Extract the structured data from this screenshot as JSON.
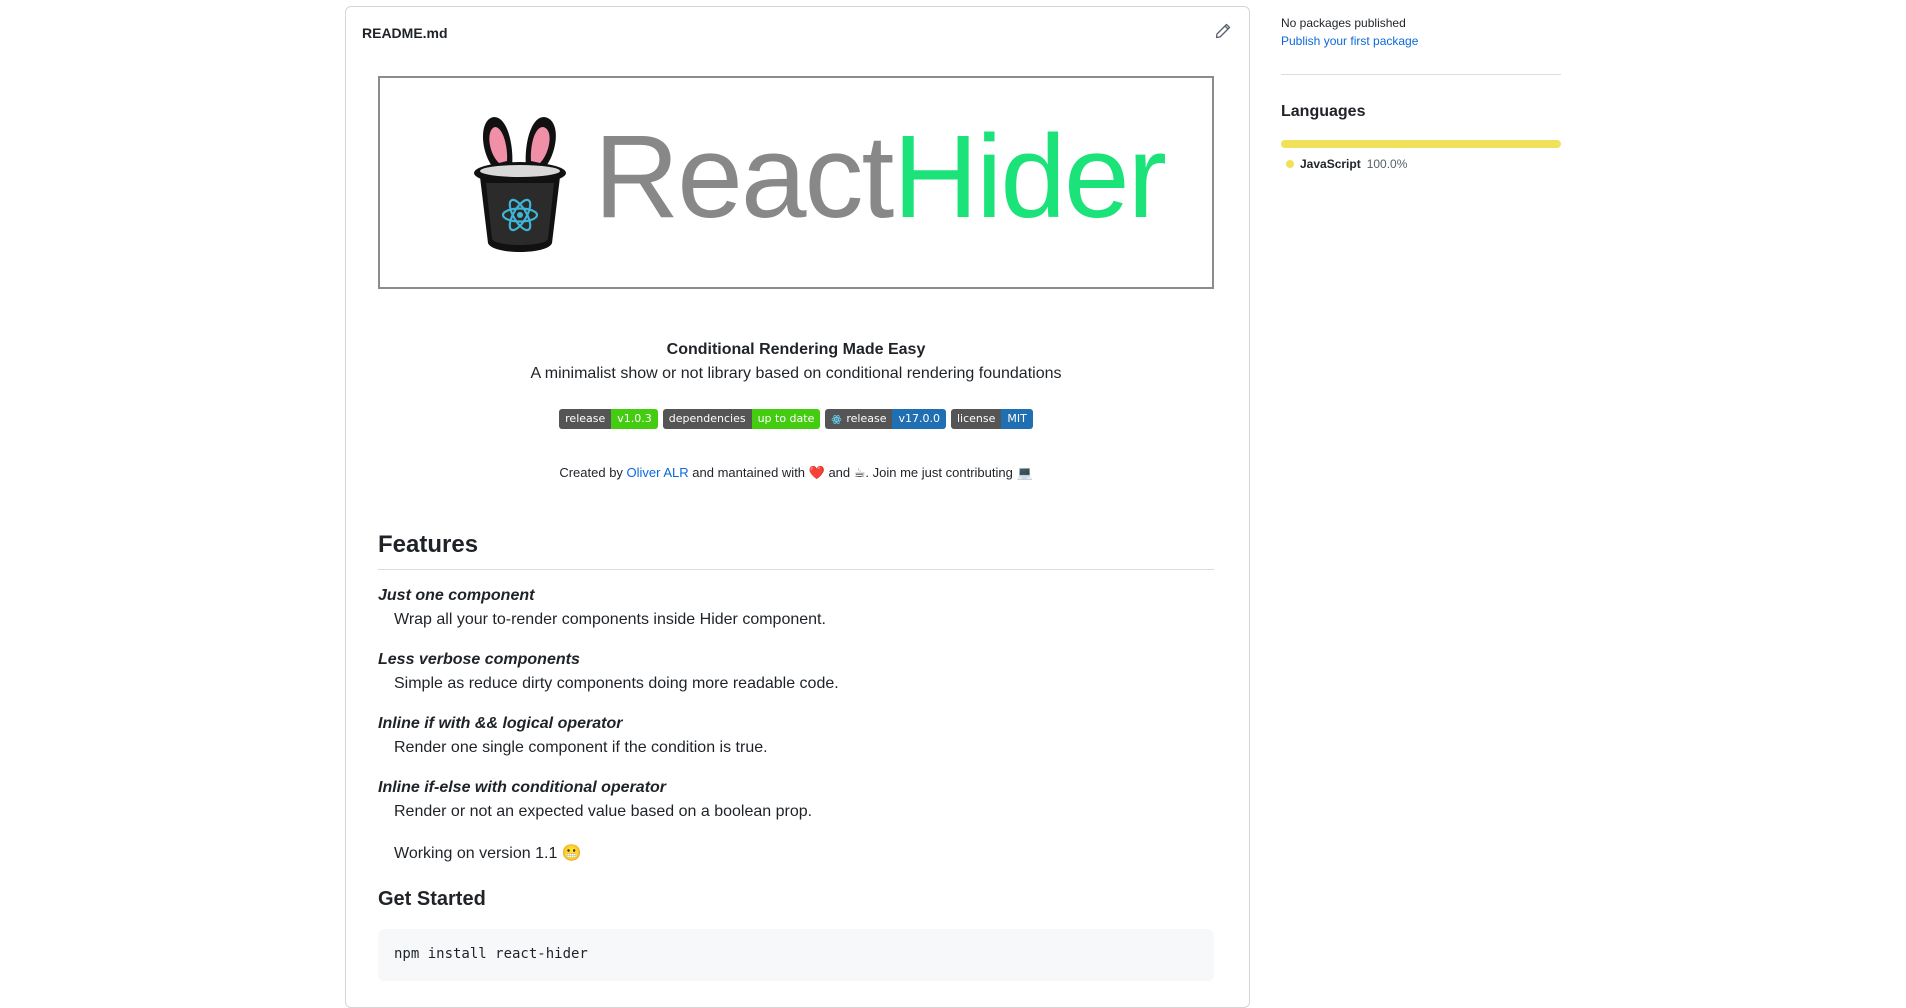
{
  "readme": {
    "filename": "README.md",
    "banner": {
      "word1": "React",
      "word2": "Hider"
    },
    "tagline_title": "Conditional Rendering Made Easy",
    "tagline_sub": "A minimalist show or not library based on conditional rendering foundations",
    "badges": [
      {
        "left": "release",
        "right": "v1.0.3",
        "color": "#4c1",
        "icon": ""
      },
      {
        "left": "dependencies",
        "right": "up to date",
        "color": "#4c1",
        "icon": ""
      },
      {
        "left": "release",
        "right": "v17.0.0",
        "color": "#1f6fb2",
        "icon": "react-icon"
      },
      {
        "left": "license",
        "right": "MIT",
        "color": "#1f6fb2",
        "icon": ""
      }
    ],
    "credits": {
      "prefix": "Created by ",
      "author": "Oliver ALR",
      "mid1": " and mantained with ",
      "heart": "❤️",
      "mid2": " and ",
      "coffee": "☕",
      "suffix": ". Join me just contributing ",
      "laptop": "💻"
    },
    "features_heading": "Features",
    "features": [
      {
        "title": "Just one component",
        "desc": "Wrap all your to-render components inside Hider component."
      },
      {
        "title": "Less verbose components",
        "desc": "Simple as reduce dirty components doing more readable code."
      },
      {
        "title": "Inline if with && logical operator",
        "desc": "Render one single component if the condition is true."
      },
      {
        "title": "Inline if-else with conditional operator",
        "desc": "Render or not an expected value based on a boolean prop."
      }
    ],
    "working_on": "Working on version 1.1 😬",
    "get_started": "Get Started",
    "install_cmd": "npm install react-hider"
  },
  "sidebar": {
    "packages_none": "No packages published",
    "packages_link": "Publish your first package",
    "languages_heading": "Languages",
    "languages": [
      {
        "name": "JavaScript",
        "percent": "100.0%",
        "fraction": 1.0,
        "color": "#f1e05a"
      }
    ]
  }
}
